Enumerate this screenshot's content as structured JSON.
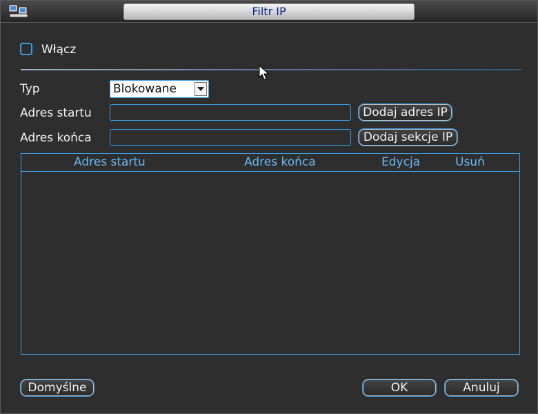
{
  "window": {
    "title": "Filtr IP"
  },
  "icons": {
    "app": "network-config-icon",
    "dropdown": "chevron-down-icon",
    "cursor": "mouse-pointer-icon"
  },
  "form": {
    "enable_label": "Włącz",
    "enable_checked": false,
    "type_label": "Typ",
    "type_value": "Blokowane",
    "start_label": "Adres startu",
    "start_value": "",
    "end_label": "Adres końca",
    "end_value": "",
    "add_ip_button": "Dodaj adres IP",
    "add_section_button": "Dodaj sekcje IP"
  },
  "table": {
    "columns": [
      "Adres startu",
      "Adres końca",
      "Edycja",
      "Usuń"
    ],
    "rows": []
  },
  "footer": {
    "default_button": "Domyślne",
    "ok_button": "OK",
    "cancel_button": "Anuluj"
  },
  "colors": {
    "accent": "#3b9de6",
    "header_text": "#6cb6f0",
    "title_text": "#0a2a8a",
    "background": "#2e2e2e"
  }
}
